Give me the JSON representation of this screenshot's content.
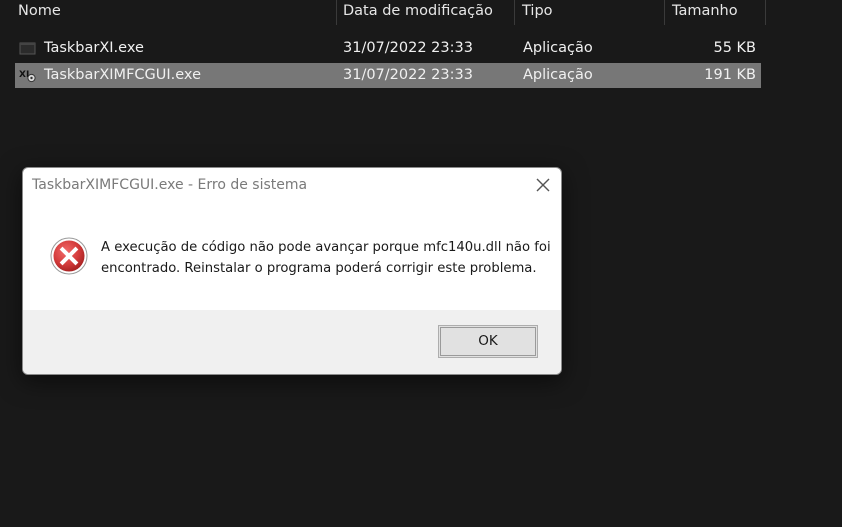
{
  "explorer": {
    "columns": {
      "name": "Nome",
      "date": "Data de modificação",
      "type": "Tipo",
      "size": "Tamanho"
    },
    "files": [
      {
        "name": "TaskbarXI.exe",
        "date": "31/07/2022 23:33",
        "type": "Aplicação",
        "size": "55 KB",
        "icon": "exe-file-icon",
        "selected": false
      },
      {
        "name": "TaskbarXIMFCGUI.exe",
        "date": "31/07/2022 23:33",
        "type": "Aplicação",
        "size": "191 KB",
        "icon": "exe-gear-file-icon",
        "selected": true
      }
    ]
  },
  "dialog": {
    "title": "TaskbarXIMFCGUI.exe - Erro de sistema",
    "message": "A execução de código não pode avançar porque mfc140u.dll não foi encontrado. Reinstalar o programa poderá corrigir este problema.",
    "ok_label": "OK",
    "icon": "error-icon",
    "close_icon": "close-icon"
  },
  "colors": {
    "background": "#191919",
    "selected_row": "#777777",
    "dialog_background": "#ffffff",
    "dialog_footer": "#f0f0f0",
    "error_red": "#d33b3b"
  }
}
